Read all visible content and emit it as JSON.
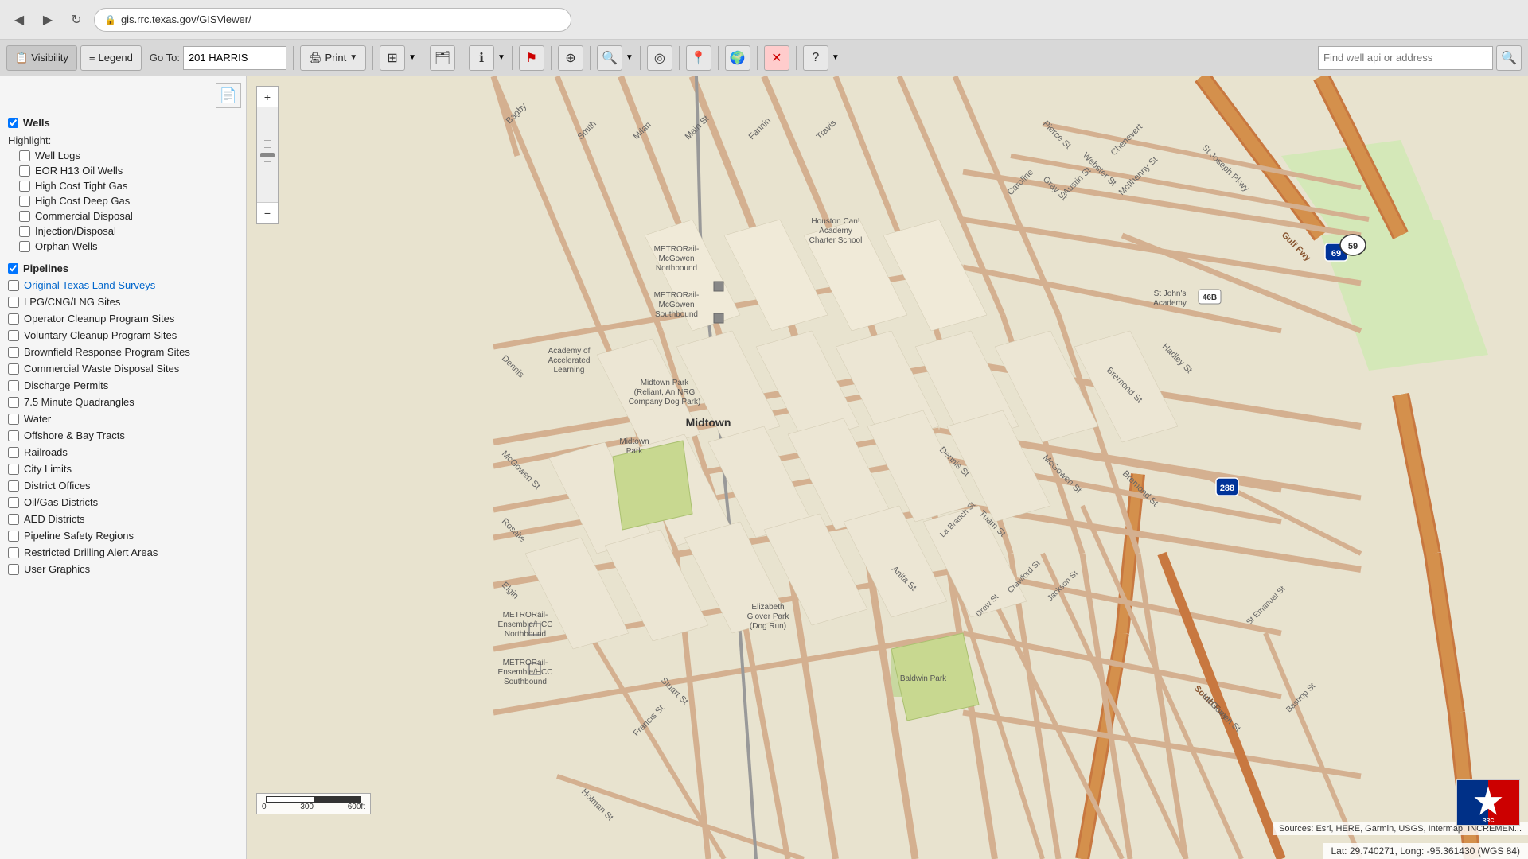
{
  "browser": {
    "url": "gis.rrc.texas.gov/GISViewer/",
    "back_label": "◀",
    "forward_label": "▶",
    "reload_label": "↻",
    "lock_icon": "🔒"
  },
  "toolbar": {
    "visibility_label": "Visibility",
    "legend_label": "Legend",
    "goto_label": "Go To:",
    "goto_value": "201 HARRIS",
    "print_label": "Print",
    "search_placeholder": "Find well api or address"
  },
  "layers": {
    "wells_checked": true,
    "wells_label": "Wells",
    "highlight_label": "Highlight:",
    "highlight_items": [
      {
        "label": "Well Logs",
        "checked": false
      },
      {
        "label": "EOR H13 Oil Wells",
        "checked": false
      },
      {
        "label": "High Cost Tight Gas",
        "checked": false
      },
      {
        "label": "High Cost Deep Gas",
        "checked": false
      },
      {
        "label": "Commercial Disposal",
        "checked": false
      },
      {
        "label": "Injection/Disposal",
        "checked": false
      },
      {
        "label": "Orphan Wells",
        "checked": false
      }
    ],
    "pipelines_checked": true,
    "pipelines_label": "Pipelines",
    "layer_items": [
      {
        "label": "Original Texas Land Surveys",
        "checked": false,
        "linked": true
      },
      {
        "label": "LPG/CNG/LNG Sites",
        "checked": false
      },
      {
        "label": "Operator Cleanup Program Sites",
        "checked": false
      },
      {
        "label": "Voluntary Cleanup Program Sites",
        "checked": false
      },
      {
        "label": "Brownfield Response Program Sites",
        "checked": false
      },
      {
        "label": "Commercial Waste Disposal Sites",
        "checked": false
      },
      {
        "label": "Discharge Permits",
        "checked": false
      },
      {
        "label": "7.5 Minute Quadrangles",
        "checked": false
      },
      {
        "label": "Water",
        "checked": false
      },
      {
        "label": "Offshore & Bay Tracts",
        "checked": false
      },
      {
        "label": "Railroads",
        "checked": false
      },
      {
        "label": "City Limits",
        "checked": false
      },
      {
        "label": "District Offices",
        "checked": false
      },
      {
        "label": "Oil/Gas Districts",
        "checked": false
      },
      {
        "label": "AED Districts",
        "checked": false
      },
      {
        "label": "Pipeline Safety Regions",
        "checked": false
      },
      {
        "label": "Restricted Drilling Alert Areas",
        "checked": false
      },
      {
        "label": "User Graphics",
        "checked": false
      }
    ]
  },
  "map": {
    "neighborhood_label": "Midtown",
    "poi_labels": [
      "METRORail-McGowen Northbound",
      "METRORail-McGowen Southbound",
      "Houston Can! Academy Charter School",
      "Midtown Park (Reliant, An NRG Company Dog Park)",
      "Midtown Park",
      "Academy of Accelerated Learning",
      "METRORail-Ensemble/HCC Northbound",
      "METRORail-Ensemble/HCC Southbound",
      "Elizabeth Glover Park (Dog Run)",
      "Baldwin Park",
      "St John's Academy"
    ],
    "sources_text": "Sources: Esri, HERE, Garmin, USGS, Intermap, INCREMEN...",
    "coords_text": "Lat: 29.740271, Long: -95.361430 (WGS 84)",
    "scale_labels": [
      "0",
      "300",
      "600ft"
    ],
    "highway_labels": [
      "59",
      "69",
      "288"
    ]
  },
  "colors": {
    "road_major": "#c8896a",
    "road_minor": "#ffffff",
    "map_bg": "#ebe6d2",
    "map_green": "#d4e8c2",
    "map_block": "#f5f0e0",
    "highway": "#d4a04a"
  }
}
